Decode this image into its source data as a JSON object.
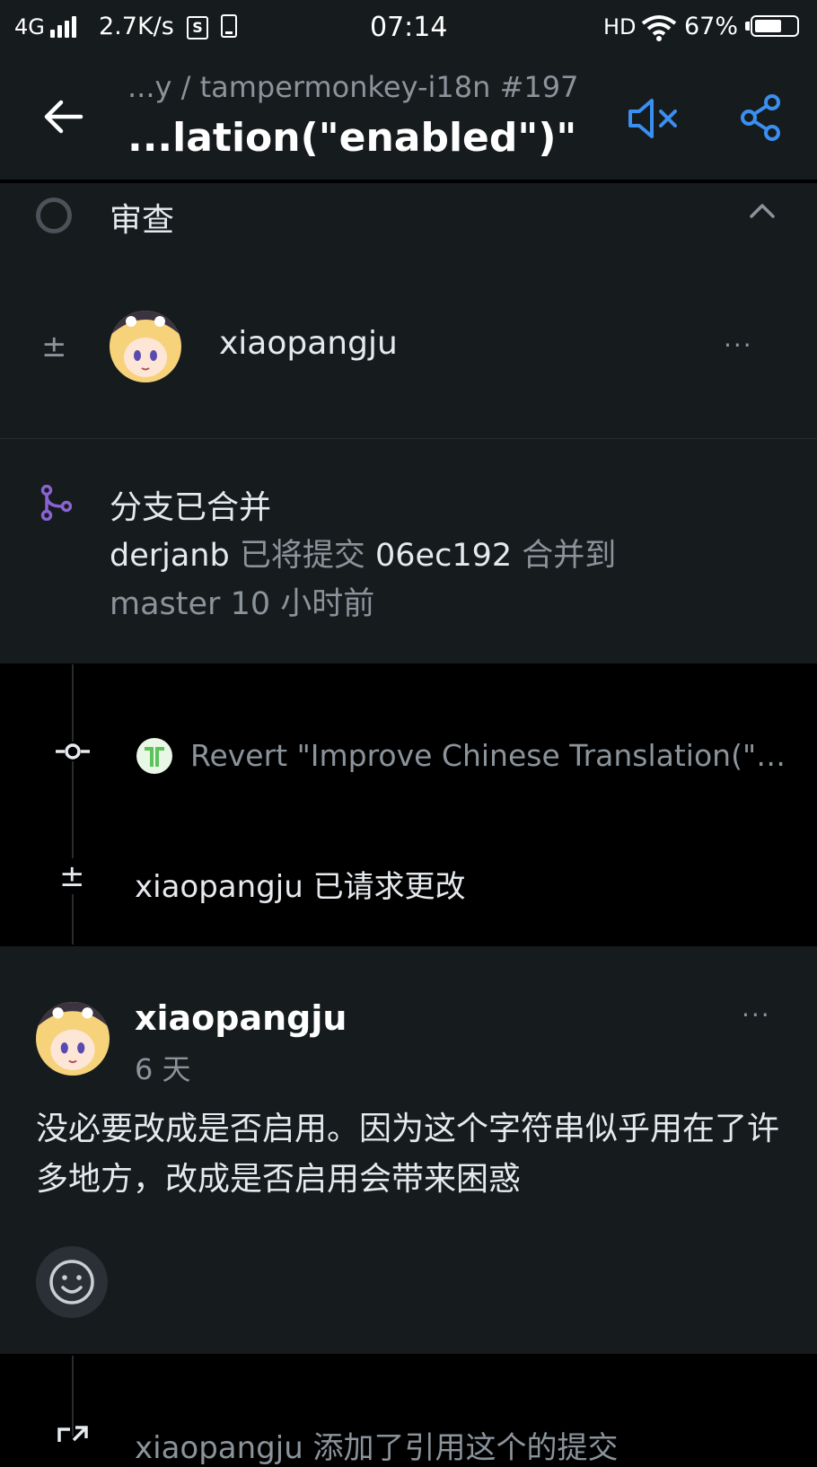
{
  "status_bar": {
    "network": "4G",
    "speed": "2.7K/s",
    "s_icon_text": "S",
    "time": "07:14",
    "hd": "HD",
    "battery": "67%",
    "battery_level": 0.67
  },
  "header": {
    "breadcrumb": "...y / tampermonkey-i18n #197",
    "title": "...lation(\"enabled\")\"",
    "back_icon": "back-arrow-icon",
    "mute_icon": "mute-icon",
    "share_icon": "share-icon",
    "accent_color": "#3a8ff0"
  },
  "reviews": {
    "title": "审查",
    "reviewer": "xiaopangju",
    "more": "···"
  },
  "merge": {
    "title": "分支已合并",
    "actor": "derjanb",
    "action": "已将提交",
    "commit": "06ec192",
    "merged_to": "合并到",
    "branch": "master",
    "time": "10 小时前",
    "icon_color": "#8a63d2"
  },
  "timeline": {
    "commit_message": "Revert \"Improve Chinese Translation(\"…",
    "request_user": "xiaopangju",
    "request_text": "已请求更改"
  },
  "comment": {
    "user": "xiaopangju",
    "time": "6 天",
    "body": "没必要改成是否启用。因为这个字符串似乎用在了许多地方，改成是否启用会带来困惑",
    "more": "···"
  },
  "bottom": {
    "text": "xiaopangju 添加了引用这个的提交"
  }
}
